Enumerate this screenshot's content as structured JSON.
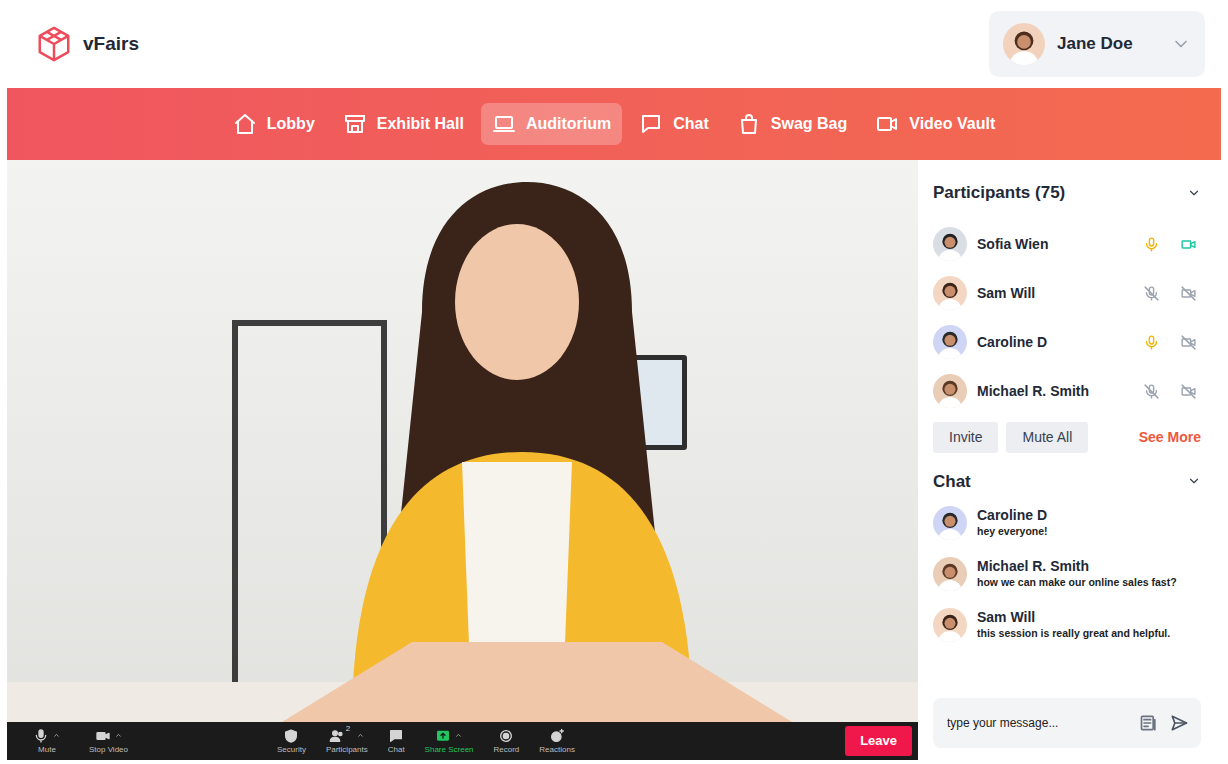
{
  "app": {
    "logo": "vFairs"
  },
  "user": {
    "name": "Jane Doe"
  },
  "nav": [
    {
      "label": "Lobby",
      "selected": false
    },
    {
      "label": "Exhibit Hall",
      "selected": false
    },
    {
      "label": "Auditorium",
      "selected": true
    },
    {
      "label": "Chat",
      "selected": false
    },
    {
      "label": "Swag Bag",
      "selected": false
    },
    {
      "label": "Video Vault",
      "selected": false
    }
  ],
  "toolbar": {
    "items": [
      {
        "label": "Mute",
        "menu": true,
        "highlighted": false
      },
      {
        "label": "Stop Video",
        "menu": true,
        "highlighted": false
      },
      {
        "label": "Security",
        "menu": false,
        "highlighted": false
      },
      {
        "label": "Participants",
        "menu": true,
        "highlighted": false,
        "badge": "2"
      },
      {
        "label": "Chat",
        "menu": false,
        "highlighted": false
      },
      {
        "label": "Share Screen",
        "menu": true,
        "highlighted": true
      },
      {
        "label": "Record",
        "menu": false,
        "highlighted": false
      },
      {
        "label": "Reactions",
        "menu": false,
        "highlighted": false
      }
    ],
    "leave": "Leave"
  },
  "participants": {
    "title": "Participants (75)",
    "items": [
      {
        "name": "Sofia Wien",
        "mic": true,
        "video": true
      },
      {
        "name": "Sam Will",
        "mic": false,
        "video": false
      },
      {
        "name": "Caroline D",
        "mic": true,
        "video": false
      },
      {
        "name": "Michael R. Smith",
        "mic": false,
        "video": false
      }
    ],
    "buttons": [
      "Invite",
      "Mute All"
    ],
    "see_more": "See More"
  },
  "chat": {
    "title": "Chat",
    "messages": [
      {
        "author": "Caroline D",
        "text": "hey everyone!"
      },
      {
        "author": "Michael R. Smith",
        "text": "how we can make our online sales fast?"
      },
      {
        "author": "Sam Will",
        "text": "this session is really great and helpful."
      }
    ],
    "placeholder": "type your message..."
  }
}
